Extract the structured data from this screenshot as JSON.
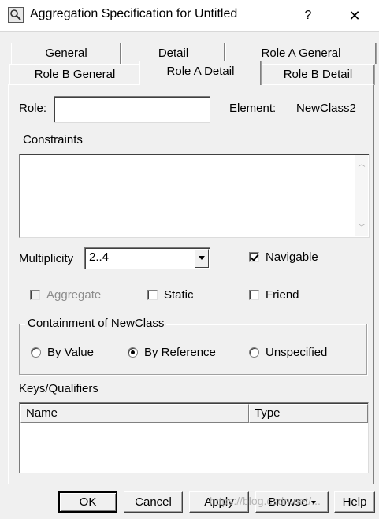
{
  "window": {
    "title": "Aggregation Specification for Untitled",
    "help_label": "?",
    "close_label": "✕"
  },
  "tabs": {
    "row_back": [
      "General",
      "Detail",
      "Role A General"
    ],
    "row_front": [
      "Role B General",
      "Role A Detail",
      "Role B Detail"
    ],
    "active": "Role A Detail"
  },
  "role": {
    "label": "Role:",
    "value": "",
    "element_label": "Element:",
    "element_value": "NewClass2"
  },
  "constraints": {
    "label": "Constraints",
    "value": ""
  },
  "multiplicity": {
    "label": "Multiplicity",
    "value": "2..4"
  },
  "checkboxes": {
    "navigable": {
      "label": "Navigable",
      "checked": true,
      "enabled": true
    },
    "aggregate": {
      "label": "Aggregate",
      "checked": false,
      "enabled": false
    },
    "static": {
      "label": "Static",
      "checked": false,
      "enabled": true
    },
    "friend": {
      "label": "Friend",
      "checked": false,
      "enabled": true
    }
  },
  "containment": {
    "title": "Containment of NewClass",
    "options": [
      "By Value",
      "By Reference",
      "Unspecified"
    ],
    "selected": "By Reference"
  },
  "keys": {
    "label": "Keys/Qualifiers",
    "columns": [
      "Name",
      "Type"
    ],
    "rows": []
  },
  "buttons": {
    "ok": "OK",
    "cancel": "Cancel",
    "apply": "Apply",
    "browse": "Browse",
    "help": "Help"
  },
  "watermark": "https://blog.csdn.net/..."
}
